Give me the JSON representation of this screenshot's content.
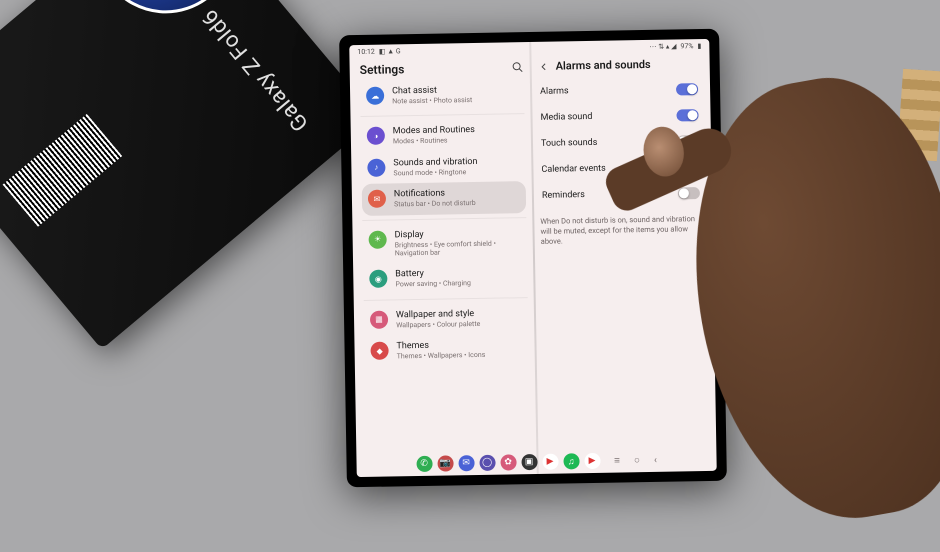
{
  "product_box": {
    "brand": "Galaxy Z Fold6"
  },
  "statusbar": {
    "time": "10:12",
    "icons_left": "◧ ▲ G",
    "icons_right": "⋯ ⇅ ▴ ◢",
    "battery_pct": "97%"
  },
  "panes": {
    "settings_title": "Settings",
    "chat_assist": {
      "title": "Chat assist",
      "subtitle": "Note assist • Photo assist"
    },
    "items": [
      {
        "title": "Modes and Routines",
        "subtitle": "Modes • Routines",
        "color": "#6b4fd0",
        "glyph": "◑"
      },
      {
        "title": "Sounds and vibration",
        "subtitle": "Sound mode • Ringtone",
        "color": "#4a63d6",
        "glyph": "♪"
      },
      {
        "title": "Notifications",
        "subtitle": "Status bar • Do not disturb",
        "color": "#e0604a",
        "glyph": "✉",
        "selected": true
      },
      {
        "title": "Display",
        "subtitle": "Brightness • Eye comfort shield • Navigation bar",
        "color": "#5fb84e",
        "glyph": "☀"
      },
      {
        "title": "Battery",
        "subtitle": "Power saving • Charging",
        "color": "#2b9e7e",
        "glyph": "◉"
      },
      {
        "title": "Wallpaper and style",
        "subtitle": "Wallpapers • Colour palette",
        "color": "#d65a7a",
        "glyph": "▦"
      },
      {
        "title": "Themes",
        "subtitle": "Themes • Wallpapers • Icons",
        "color": "#d84a4a",
        "glyph": "◆"
      }
    ]
  },
  "detail": {
    "title": "Alarms and sounds",
    "toggles": [
      {
        "label": "Alarms",
        "on": true
      },
      {
        "label": "Media sound",
        "on": true
      },
      {
        "label": "Touch sounds",
        "on": false
      },
      {
        "label": "Calendar events",
        "on": false
      },
      {
        "label": "Reminders",
        "on": false
      }
    ],
    "helper": "When Do not disturb is on, sound and vibration will be muted, except for the items you allow above."
  },
  "dock": {
    "apps": [
      {
        "name": "phone",
        "color": "#2fae52",
        "glyph": "✆"
      },
      {
        "name": "camera",
        "color": "#c54a4a",
        "glyph": "📷"
      },
      {
        "name": "messages",
        "color": "#4a62d6",
        "glyph": "✉"
      },
      {
        "name": "internet",
        "color": "#5a4fae",
        "glyph": "◯"
      },
      {
        "name": "gallery",
        "color": "#d65a7a",
        "glyph": "✿"
      },
      {
        "name": "store",
        "color": "#333",
        "glyph": "▣"
      },
      {
        "name": "youtube",
        "color": "#fff",
        "glyph": "▶"
      },
      {
        "name": "spotify",
        "color": "#1db954",
        "glyph": "♫"
      },
      {
        "name": "play",
        "color": "#fff",
        "glyph": "▶"
      }
    ],
    "nav": {
      "recent": "≡",
      "home": "○",
      "back": "‹"
    }
  }
}
